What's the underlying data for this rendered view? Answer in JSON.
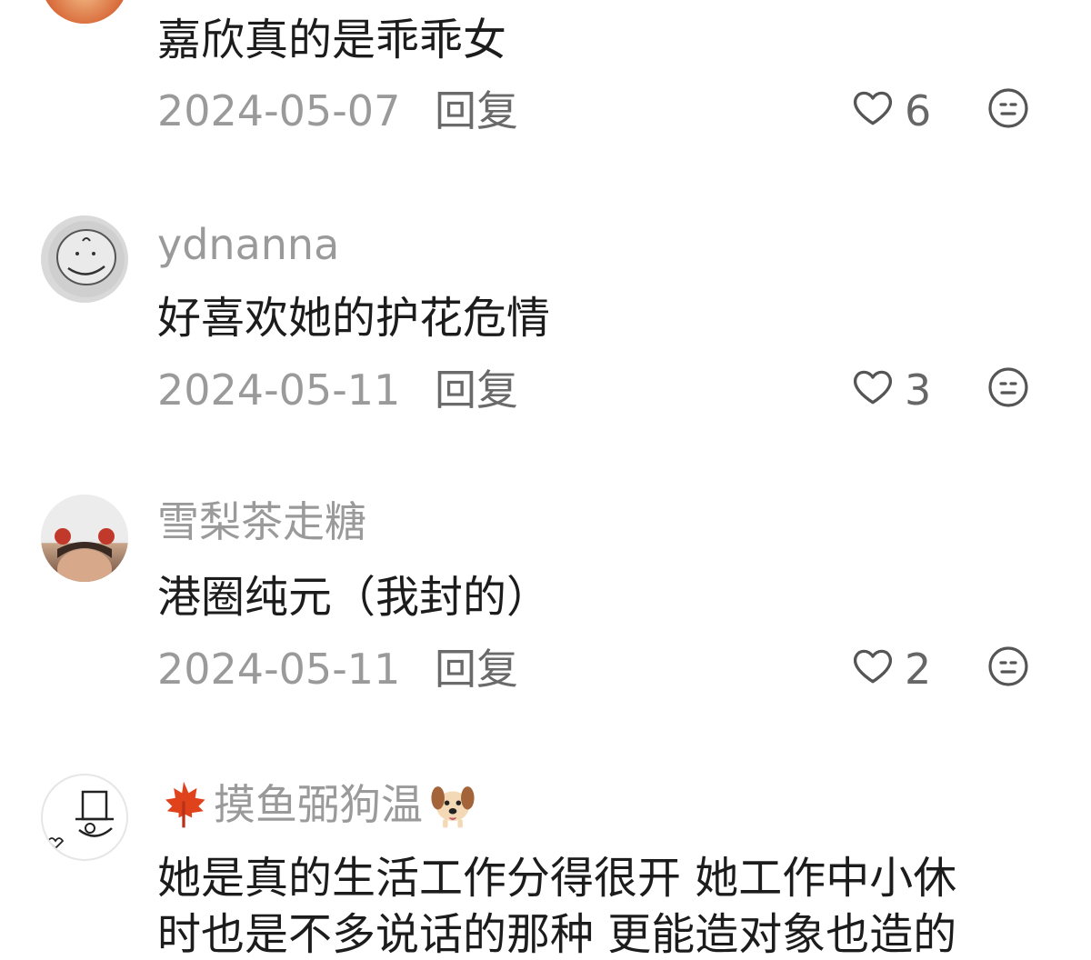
{
  "comments": [
    {
      "username": "",
      "text": "嘉欣真的是乖乖女",
      "date": "2024-05-07",
      "reply": "回复",
      "likes": "6"
    },
    {
      "username": "ydnanna",
      "text": "好喜欢她的护花危情",
      "date": "2024-05-11",
      "reply": "回复",
      "likes": "3"
    },
    {
      "username": "雪梨茶走糖",
      "text": "港圈纯元（我封的）",
      "date": "2024-05-11",
      "reply": "回复",
      "likes": "2"
    },
    {
      "username": "摸鱼弼狗温",
      "text": "她是真的生活工作分得很开 她工作中小休",
      "text_line2": "时也是不多说话的那种 更能造对象也造的"
    }
  ],
  "icons": {
    "like": "heart-outline-icon",
    "more": "neutral-face-icon",
    "leaf": "maple-leaf-icon",
    "dog": "dog-face-icon"
  },
  "colors": {
    "text": "#1c1c1c",
    "muted": "#9a9a9a"
  }
}
